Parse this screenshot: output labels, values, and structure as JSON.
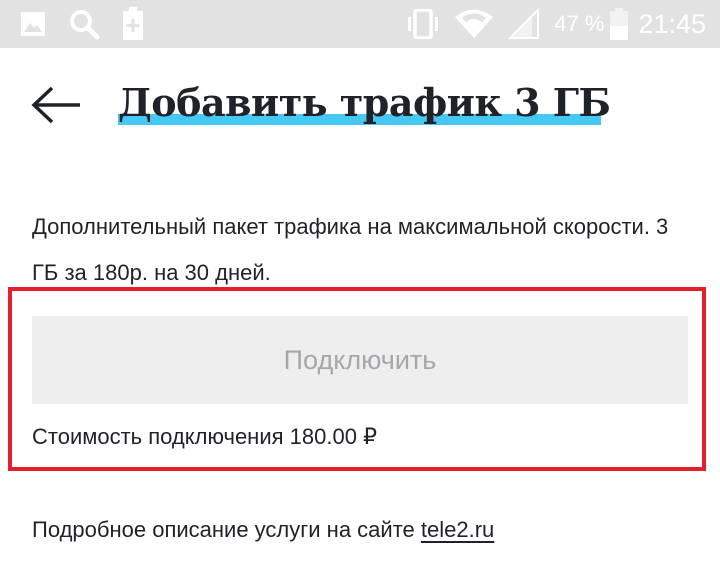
{
  "status_bar": {
    "icons_left": [
      "image-icon",
      "search-icon",
      "battery-saver-icon"
    ],
    "icons_right": [
      "vibrate-icon",
      "wifi-icon",
      "signal-icon"
    ],
    "battery_percent": "47 %",
    "time": "21:45"
  },
  "header": {
    "back_icon": "arrow-left-icon",
    "title": "Добавить трафик 3 ГБ",
    "accent_color": "#46c8f5"
  },
  "main": {
    "description": "Дополнительный пакет трафика на максимальной скорости. 3 ГБ за 180р. на 30 дней.",
    "connect_button_label": "Подключить",
    "price_text": "Стоимость подключения 180.00 ₽",
    "highlight_color": "#e3202c"
  },
  "footer": {
    "text": "Подробное описание услуги на сайте ",
    "link_text": "tele2.ru"
  }
}
